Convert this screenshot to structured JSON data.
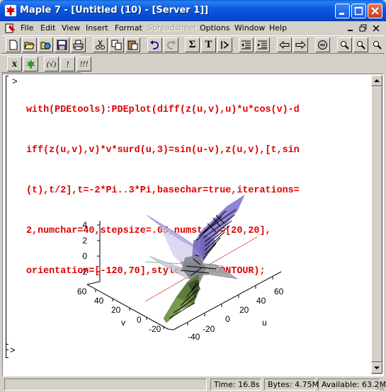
{
  "window": {
    "title": "Maple 7  - [Untitled (10) - [Server 1]]"
  },
  "menu": {
    "items": [
      "File",
      "Edit",
      "View",
      "Insert",
      "Format",
      "Spreadsheet",
      "Options",
      "Window",
      "Help"
    ],
    "disabled": [
      "Spreadsheet"
    ]
  },
  "toolbar": {
    "sum_label": "Σ",
    "text_label": "T",
    "math_label": "(√)",
    "exec_label": "!",
    "exec_all_label": "!!!",
    "x_label": "x"
  },
  "worksheet": {
    "prompt": ">",
    "command_lines": [
      "with(PDEtools):PDEplot(diff(z(u,v),u)*u*cos(v)-d",
      "iff(z(u,v),v)*v*surd(u,3)=sin(u-v),z(u,v),[t,sin",
      "(t),t/2],t=-2*Pi..3*Pi,basechar=true,iterations=",
      "2,numchar=40,stepsize=.05,numsteps=[20,20],",
      "orientation=[-120,70],style=PATCHCONTOUR);"
    ],
    "empty_prompt": ">"
  },
  "plot": {
    "z_ticks": [
      "4",
      "2",
      "0",
      "-2"
    ],
    "v_ticks": [
      "60",
      "40",
      "20",
      "0",
      "-20"
    ],
    "u_ticks": [
      "60",
      "40",
      "20",
      "0",
      "-20",
      "-40"
    ],
    "v_label": "v",
    "u_label": "u",
    "colors": {
      "surface_purple": "#9b8fd6",
      "surface_green": "#7a9a50",
      "surface_gray": "#a0a0a0",
      "axis_red": "#e06060",
      "axis_green": "#70c070"
    }
  },
  "status": {
    "time": "Time:  16.8s",
    "bytes": "Bytes: 4.75M",
    "available": "Available: 63.2M"
  }
}
